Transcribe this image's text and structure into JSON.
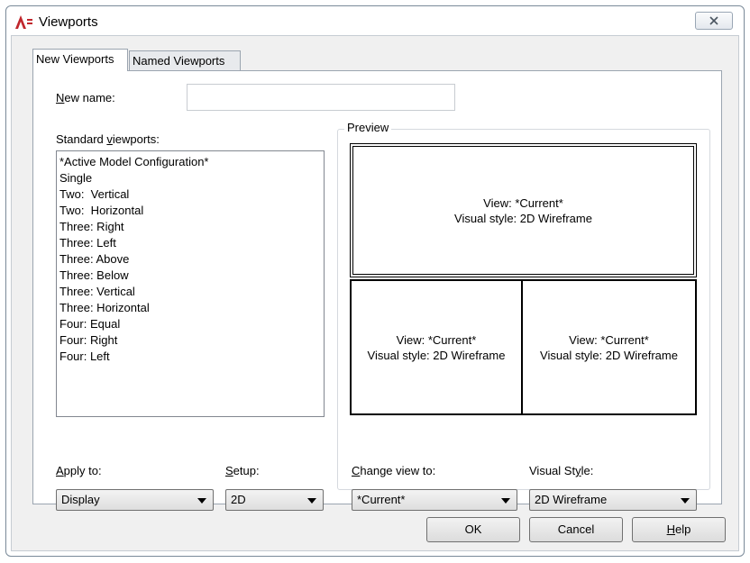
{
  "window": {
    "title": "Viewports",
    "close_icon": "close-icon"
  },
  "tabs": [
    {
      "label": "New Viewports",
      "active": true
    },
    {
      "label": "Named Viewports",
      "active": false
    }
  ],
  "new_name": {
    "label_pre": "N",
    "label_rest": "ew name:",
    "value": ""
  },
  "standard_viewports": {
    "label_pre": "Standard ",
    "label_u": "v",
    "label_rest": "iewports:",
    "items": [
      "*Active Model Configuration*",
      "Single",
      "Two:  Vertical",
      "Two:  Horizontal",
      "Three: Right",
      "Three: Left",
      "Three: Above",
      "Three: Below",
      "Three: Vertical",
      "Three: Horizontal",
      "Four: Equal",
      "Four: Right",
      "Four: Left"
    ]
  },
  "preview": {
    "legend": "Preview",
    "top": {
      "line1": "View: *Current*",
      "line2": "Visual style: 2D Wireframe"
    },
    "bottom_left": {
      "line1": "View: *Current*",
      "line2": "Visual style: 2D Wireframe"
    },
    "bottom_right": {
      "line1": "View: *Current*",
      "line2": "Visual style: 2D Wireframe"
    }
  },
  "apply_to": {
    "label_u": "A",
    "label_rest": "pply to:",
    "value": "Display"
  },
  "setup": {
    "label_u": "S",
    "label_rest": "etup:",
    "value": "2D"
  },
  "change_view_to": {
    "label_u": "C",
    "label_rest": "hange view to:",
    "value": "*Current*"
  },
  "visual_style": {
    "label_pre": "Visual St",
    "label_u": "y",
    "label_rest": "le:",
    "value": "2D Wireframe"
  },
  "buttons": {
    "ok": "OK",
    "cancel": "Cancel",
    "help_u": "H",
    "help_rest": "elp"
  },
  "colors": {
    "app_icon": "#c0272d",
    "accent": "#3c7fb1"
  }
}
